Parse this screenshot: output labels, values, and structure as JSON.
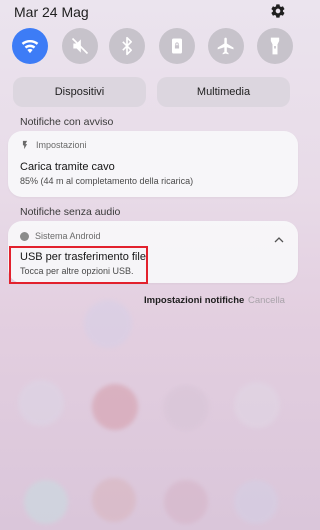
{
  "status": {
    "date": "Mar 24 Mag"
  },
  "quick_toggles": [
    {
      "name": "wifi",
      "on": true
    },
    {
      "name": "mute",
      "on": false
    },
    {
      "name": "bluetooth",
      "on": false
    },
    {
      "name": "rotation-lock",
      "on": false
    },
    {
      "name": "airplane-mode",
      "on": false
    },
    {
      "name": "flashlight",
      "on": false
    }
  ],
  "buttons": {
    "devices": "Dispositivi",
    "media": "Multimedia"
  },
  "sections": {
    "alerting": "Notifiche con avviso",
    "silent": "Notifiche senza audio"
  },
  "notif_charging": {
    "app": "Impostazioni",
    "title": "Carica tramite cavo",
    "text": "85% (44 m al completamento della ricarica)"
  },
  "notif_usb": {
    "app": "Sistema Android",
    "title": "USB per trasferimento file",
    "text": "Tocca per altre opzioni USB."
  },
  "actions": {
    "settings": "Impostazioni notifiche",
    "clear": "Cancella"
  },
  "colors": {
    "accent": "#3d7cf6",
    "highlight": "#e2212d"
  }
}
